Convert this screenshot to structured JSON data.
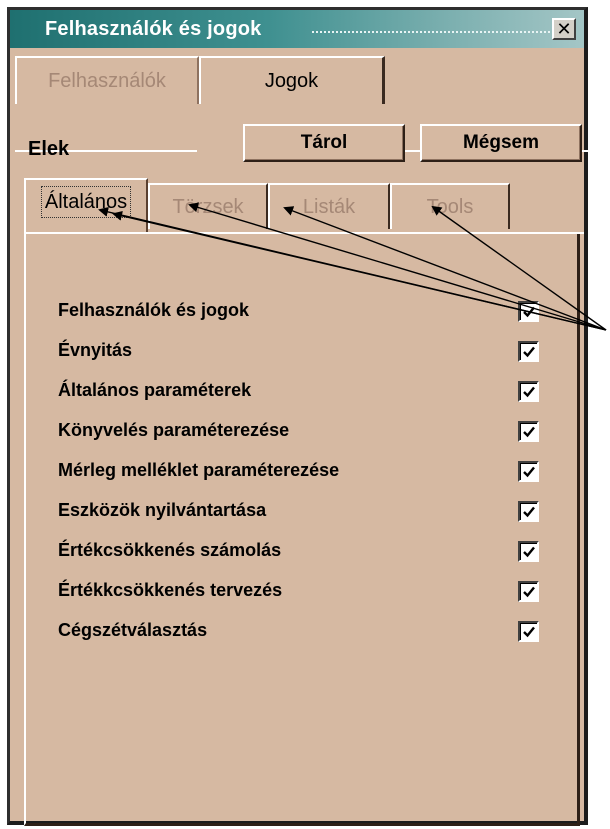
{
  "window": {
    "title": "Felhasználók és jogok"
  },
  "top_tabs": [
    {
      "label": "Felhasználók",
      "state": "inactive"
    },
    {
      "label": "Jogok",
      "state": "active"
    }
  ],
  "section": {
    "label": "Elek"
  },
  "buttons": {
    "save": "Tárol",
    "cancel": "Mégsem"
  },
  "sub_tabs": [
    {
      "label": "Általános",
      "state": "active"
    },
    {
      "label": "Törzsek",
      "state": "inactive"
    },
    {
      "label": "Listák",
      "state": "inactive"
    },
    {
      "label": "Tools",
      "state": "inactive"
    }
  ],
  "permissions": [
    {
      "label": "Felhasználók és jogok",
      "checked": true
    },
    {
      "label": "Évnyitás",
      "checked": true
    },
    {
      "label": "Általános paraméterek",
      "checked": true
    },
    {
      "label": "Könyvelés paraméterezése",
      "checked": true
    },
    {
      "label": "Mérleg melléklet paraméterezése",
      "checked": true
    },
    {
      "label": "Eszközök nyilvántartása",
      "checked": true
    },
    {
      "label": "Értékcsökkenés számolás",
      "checked": true
    },
    {
      "label": "Értékkcsökkenés tervezés",
      "checked": true
    },
    {
      "label": "Cégszétválasztás",
      "checked": true
    }
  ],
  "colors": {
    "window_bg": "#d6b9a2",
    "titlebar": "#1f7070",
    "inactive_text": "#a58876"
  }
}
